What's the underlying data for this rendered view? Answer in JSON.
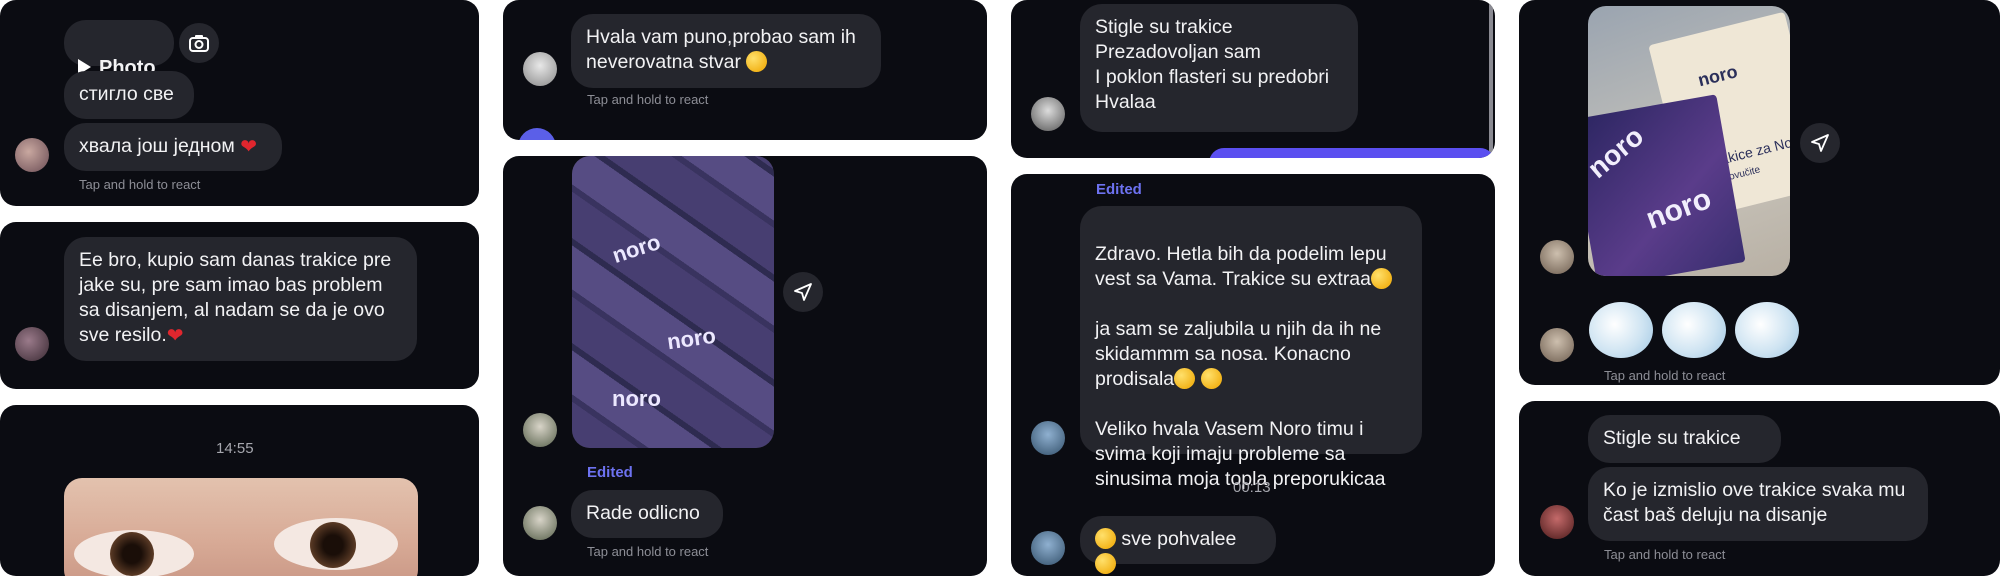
{
  "hint": "Tap and hold to react",
  "edited": "Edited",
  "p1": {
    "photo_label": "Photo",
    "msg1": "стигло све",
    "msg2": "хвала још једном"
  },
  "p2": {
    "msg": "Ee bro, kupio sam danas trakice pre\njake su, pre sam imao bas problem\nsa disanjem, al nadam se da je ovo\nsve resilo."
  },
  "p3": {
    "time": "14:55"
  },
  "p4": {
    "msg": "Hvala vam puno,probao sam ih\nneverovatna stvar"
  },
  "p5": {
    "pack_logo": "noro",
    "msg": "Rade odlicno"
  },
  "p6": {
    "msg": "Stigle su trakice\nPrezadovoljan sam\nI poklon flasteri su predobri\nHvalaa"
  },
  "p7": {
    "msg_a": "Zdravo. Hetla bih da podelim lepu\nvest sa Vama. Trakice su extraa",
    "msg_b": "ja sam se zaljubila u njih da ih ne\nskidammm sa nosa. Konacno\nprodisala",
    "msg_c": "Veliko hvala Vasem Noro timu i\nsvima koji imaju probleme sa\nsinusima moja topla preporukicaa",
    "time": "00:13",
    "msg2": "sve pohvalee"
  },
  "p8": {
    "logo": "noro",
    "box_text": "Trakice za Nos",
    "box_sub": "Povučite"
  },
  "p9": {
    "msg1": "Stigle su trakice",
    "msg2": "Ko je izmislio ove trakice svaka mu\nčast baš deluju na disanje"
  }
}
